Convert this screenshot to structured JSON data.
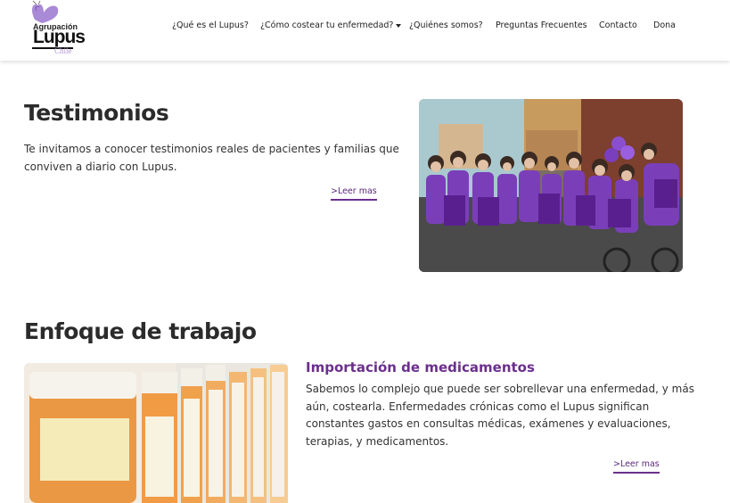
{
  "logo": {
    "top_text": "Agrupación",
    "main_text": "Lupus",
    "sub_text": "Chile"
  },
  "nav": {
    "items": [
      {
        "label": "¿Qué es el Lupus?"
      },
      {
        "label": "¿Cómo costear tu enfermedad?"
      },
      {
        "label": "¿Quiénes somos?"
      },
      {
        "label": "Preguntas Frecuentes"
      },
      {
        "label": "Contacto"
      },
      {
        "label": "Dona"
      }
    ]
  },
  "testimonios": {
    "title": "Testimonios",
    "text": "Te invitamos a conocer testimonios reales de pacientes y familias que conviven a diario con Lupus.",
    "link": ">Leer mas"
  },
  "enfoque": {
    "title": "Enfoque de trabajo",
    "card": {
      "title": "Importación de medicamentos",
      "text": "Sabemos lo complejo que puede ser sobrellevar una enfermedad, y más aún, costearla. Enfermedades crónicas como el Lupus significan constantes gastos en consultas médicas, exámenes y evaluaciones, terapias, y medicamentos.",
      "link": ">Leer mas"
    }
  },
  "colors": {
    "accent": "#6b2f8c",
    "brand_lilac": "#b79ad8",
    "heading": "#2b2b2b"
  }
}
